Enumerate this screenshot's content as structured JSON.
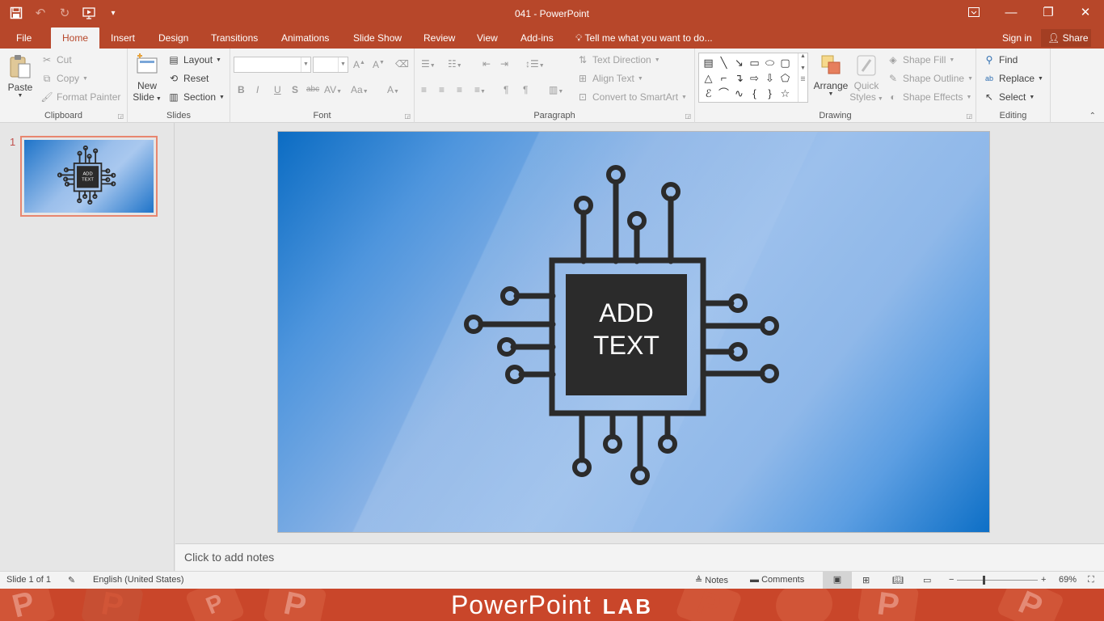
{
  "titlebar": {
    "title": "041 - PowerPoint",
    "quick_access": [
      "save-icon",
      "undo-icon",
      "redo-icon",
      "start-from-beginning-icon",
      "customize-qat-icon"
    ],
    "window_controls": [
      "ribbon-display-icon",
      "minimize-icon",
      "restore-icon",
      "close-icon"
    ]
  },
  "tabs": {
    "file": "File",
    "home": "Home",
    "insert": "Insert",
    "design": "Design",
    "transitions": "Transitions",
    "animations": "Animations",
    "slideshow": "Slide Show",
    "review": "Review",
    "view": "View",
    "addins": "Add-ins",
    "tellme": "Tell me what you want to do...",
    "signin": "Sign in",
    "share": "Share"
  },
  "ribbon": {
    "clipboard": {
      "label": "Clipboard",
      "paste": "Paste",
      "cut": "Cut",
      "copy": "Copy",
      "format_painter": "Format Painter"
    },
    "slides": {
      "label": "Slides",
      "new_slide": "New",
      "new_slide2": "Slide",
      "layout": "Layout",
      "reset": "Reset",
      "section": "Section"
    },
    "font": {
      "label": "Font"
    },
    "paragraph": {
      "label": "Paragraph",
      "text_direction": "Text Direction",
      "align_text": "Align Text",
      "convert_smartart": "Convert to SmartArt"
    },
    "drawing": {
      "label": "Drawing",
      "arrange": "Arrange",
      "quick_styles": "Quick",
      "quick_styles2": "Styles",
      "shape_fill": "Shape Fill",
      "shape_outline": "Shape Outline",
      "shape_effects": "Shape Effects"
    },
    "editing": {
      "label": "Editing",
      "find": "Find",
      "replace": "Replace",
      "select": "Select"
    }
  },
  "slides_pane": {
    "slide_number": "1",
    "thumb_text_line1": "ADD",
    "thumb_text_line2": "TEXT"
  },
  "slide": {
    "title_line1": "ADD",
    "title_line2": "TEXT",
    "chip_color": "#2b2b2b",
    "background_accent": "#0b6cc3"
  },
  "notes": {
    "placeholder": "Click to add notes"
  },
  "statusbar": {
    "slide_info": "Slide 1 of 1",
    "language": "English (United States)",
    "notes": "Notes",
    "comments": "Comments",
    "zoom": "69%"
  },
  "banner": {
    "text1": "PowerPoint",
    "text2": "LAB"
  }
}
